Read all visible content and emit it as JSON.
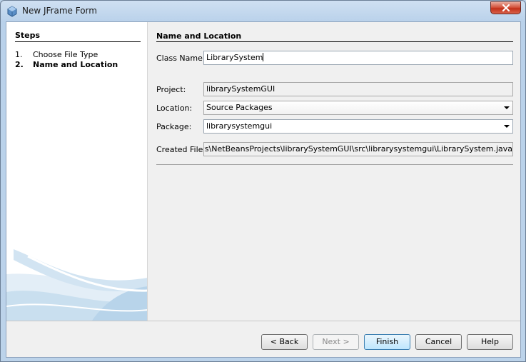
{
  "window": {
    "title": "New JFrame Form",
    "close_icon": "close-icon"
  },
  "steps": {
    "title": "Steps",
    "items": [
      {
        "number": "1.",
        "label": "Choose File Type",
        "current": false
      },
      {
        "number": "2.",
        "label": "Name and Location",
        "current": true
      }
    ]
  },
  "form": {
    "title": "Name and Location",
    "class_name": {
      "label": "Class Name:",
      "value": "LibrarySystem"
    },
    "project": {
      "label": "Project:",
      "value": "librarySystemGUI"
    },
    "location": {
      "label": "Location:",
      "value": "Source Packages"
    },
    "package": {
      "label": "Package:",
      "value": "librarysystemgui"
    },
    "created_file": {
      "label": "Created File:",
      "value": "MiguelDocs\\NetBeansProjects\\librarySystemGUI\\src\\librarysystemgui\\LibrarySystem.java"
    }
  },
  "buttons": {
    "back": "< Back",
    "next": "Next >",
    "finish": "Finish",
    "cancel": "Cancel",
    "help": "Help"
  },
  "colors": {
    "titlebar": "#bcd3ea",
    "close_button": "#c2301a",
    "default_button_border": "#3c7fb1"
  }
}
